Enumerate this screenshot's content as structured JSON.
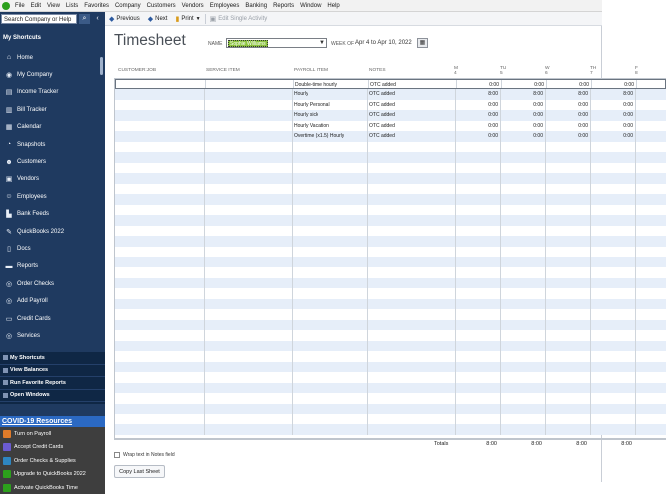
{
  "menubar": {
    "items": [
      "File",
      "Edit",
      "View",
      "Lists",
      "Favorites",
      "Company",
      "Customers",
      "Vendors",
      "Employees",
      "Banking",
      "Reports",
      "Window",
      "Help"
    ]
  },
  "sidebar": {
    "search_placeholder": "Search Company or Help",
    "shortcuts_title": "My Shortcuts",
    "items": [
      {
        "label": "Home",
        "icon": "home-icon"
      },
      {
        "label": "My Company",
        "icon": "company-icon"
      },
      {
        "label": "Income Tracker",
        "icon": "income-tracker-icon"
      },
      {
        "label": "Bill Tracker",
        "icon": "bill-tracker-icon"
      },
      {
        "label": "Calendar",
        "icon": "calendar-icon"
      },
      {
        "label": "Snapshots",
        "icon": "snapshots-icon"
      },
      {
        "label": "Customers",
        "icon": "customers-icon"
      },
      {
        "label": "Vendors",
        "icon": "vendors-icon"
      },
      {
        "label": "Employees",
        "icon": "employees-icon"
      },
      {
        "label": "Bank Feeds",
        "icon": "bank-feeds-icon"
      },
      {
        "label": "QuickBooks 2022",
        "icon": "quickbooks-icon"
      },
      {
        "label": "Docs",
        "icon": "docs-icon"
      },
      {
        "label": "Reports",
        "icon": "reports-icon"
      },
      {
        "label": "Order Checks",
        "icon": "order-checks-icon"
      },
      {
        "label": "Add Payroll",
        "icon": "add-payroll-icon"
      },
      {
        "label": "Credit Cards",
        "icon": "credit-cards-icon"
      },
      {
        "label": "Services",
        "icon": "services-icon"
      }
    ],
    "sections": [
      "My Shortcuts",
      "View Balances",
      "Run Favorite Reports",
      "Open Windows"
    ],
    "covid_title": "COVID-19 Resources",
    "promos": [
      {
        "label": "Turn on Payroll",
        "color": "#e07b2a"
      },
      {
        "label": "Accept Credit Cards",
        "color": "#6b5bd2"
      },
      {
        "label": "Order Checks & Supplies",
        "color": "#2e86c1"
      },
      {
        "label": "Upgrade to QuickBooks 2022",
        "color": "#2ca01c"
      },
      {
        "label": "Activate QuickBooks Time",
        "color": "#2ca01c"
      }
    ]
  },
  "toolbar": {
    "previous_label": "Previous",
    "next_label": "Next",
    "print_label": "Print",
    "edit_single_label": "Edit Single Activity"
  },
  "form": {
    "title": "Timesheet",
    "name_label": "NAME",
    "name_value": "Sophie Williams",
    "week_label": "WEEK OF",
    "week_value": "Apr 4 to Apr 10, 2022"
  },
  "grid": {
    "headers": {
      "customer_job": "CUSTOMER:JOB",
      "service_item": "SERVICE ITEM",
      "payroll_item": "PAYROLL ITEM",
      "notes": "NOTES"
    },
    "days": [
      {
        "top": "M",
        "bottom": "4"
      },
      {
        "top": "TU",
        "bottom": "5"
      },
      {
        "top": "W",
        "bottom": "6"
      },
      {
        "top": "TH",
        "bottom": "7"
      },
      {
        "top": "F",
        "bottom": "8"
      }
    ],
    "rows": [
      {
        "payroll_item": "Double-time hourly",
        "notes": "OTC added",
        "hours": [
          "0:00",
          "0:00",
          "0:00",
          "0:00"
        ]
      },
      {
        "payroll_item": "Hourly",
        "notes": "OTC added",
        "hours": [
          "8:00",
          "8:00",
          "8:00",
          "8:00"
        ]
      },
      {
        "payroll_item": "Hourly Personal",
        "notes": "OTC added",
        "hours": [
          "0:00",
          "0:00",
          "0:00",
          "0:00"
        ]
      },
      {
        "payroll_item": "Hourly sick",
        "notes": "OTC added",
        "hours": [
          "0:00",
          "0:00",
          "0:00",
          "0:00"
        ]
      },
      {
        "payroll_item": "Hourly Vacation",
        "notes": "OTC added",
        "hours": [
          "0:00",
          "0:00",
          "0:00",
          "0:00"
        ]
      },
      {
        "payroll_item": "Overtime (x1.5) Hourly",
        "notes": "OTC added",
        "hours": [
          "0:00",
          "0:00",
          "0:00",
          "0:00"
        ]
      }
    ],
    "totals_label": "Totals",
    "totals": [
      "8:00",
      "8:00",
      "8:00",
      "8:00"
    ]
  },
  "footer": {
    "wrap_label": "Wrap text in Notes field",
    "copy_last_label": "Copy Last Sheet"
  }
}
